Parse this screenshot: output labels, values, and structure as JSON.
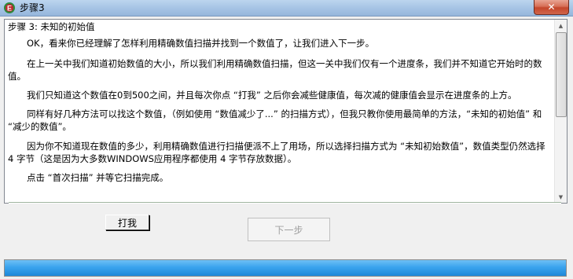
{
  "window": {
    "title": "步骤3",
    "close_symbol": "✕"
  },
  "content": {
    "heading": "步骤 3: 未知的初始值",
    "paragraphs": [
      "OK，看来你已经理解了怎样利用精确数值扫描并找到一个数值了，让我们进入下一步。",
      "在上一关中我们知道初始数值的大小，所以我们利用精确数值扫描，但这一关中我们仅有一个进度条，我们并不知道它开始时的数值。",
      "我们只知道这个数值在0到500之间，并且每次你点 “打我” 之后你会减些健康值，每次减的健康值会显示在进度条的上方。",
      "同样有好几种方法可以找这个数值，（例如使用 “数值减少了...” 的扫描方式），但我只教你使用最简单的方法，“未知的初始值” 和 “减少的数值”。",
      "因为你不知道现在数值的多少，利用精确数值进行扫描便派不上了用场，所以选择扫描方式为 “未知初始数值”，数值类型仍然选择 4 字节（这是因为大多数WINDOWS应用程序都使用 4 字节存放数据）。",
      "点击 “首次扫描” 并等它扫描完成。"
    ]
  },
  "buttons": {
    "hit_label": "打我",
    "next_label": "下一步"
  },
  "health_bar": {
    "fill_percent": 100,
    "color": "#2f96e6"
  },
  "icons": {
    "app": "cheat-engine-icon",
    "scroll_up": "scroll-up-arrow-icon",
    "scroll_down": "scroll-down-arrow-icon"
  }
}
